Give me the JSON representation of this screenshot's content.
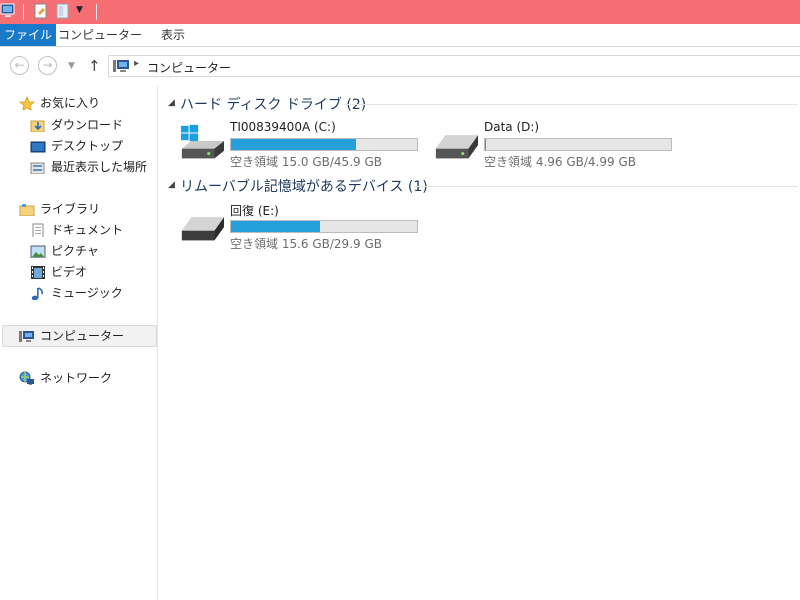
{
  "colors": {
    "titlebar": "#f46e74",
    "file_tab": "#1979ca",
    "bar_fill": "#26a0da",
    "group_title": "#1e395b"
  },
  "quick_access": {
    "icons": [
      "computer-icon",
      "properties-icon",
      "new-folder-icon",
      "customize-chevron-icon"
    ]
  },
  "ribbon": {
    "tabs": [
      "ファイル",
      "コンピューター",
      "表示"
    ]
  },
  "address": {
    "path": "コンピューター"
  },
  "nav": {
    "favorites": {
      "label": "お気に入り",
      "items": [
        "ダウンロード",
        "デスクトップ",
        "最近表示した場所"
      ]
    },
    "libraries": {
      "label": "ライブラリ",
      "items": [
        "ドキュメント",
        "ピクチャ",
        "ビデオ",
        "ミュージック"
      ]
    },
    "computer": "コンピューター",
    "network": "ネットワーク"
  },
  "groups": [
    {
      "title": "ハード ディスク ドライブ (2)",
      "drives": [
        {
          "name": "TI00839400A (C:)",
          "free": "空き領域 15.0 GB/45.9 GB",
          "used_fraction": 0.673
        },
        {
          "name": "Data (D:)",
          "free": "空き領域 4.96 GB/4.99 GB",
          "used_fraction": 0.006
        }
      ]
    },
    {
      "title": "リムーバブル記憶域があるデバイス (1)",
      "drives": [
        {
          "name": "回復 (E:)",
          "free": "空き領域 15.6 GB/29.9 GB",
          "used_fraction": 0.478
        }
      ]
    }
  ]
}
